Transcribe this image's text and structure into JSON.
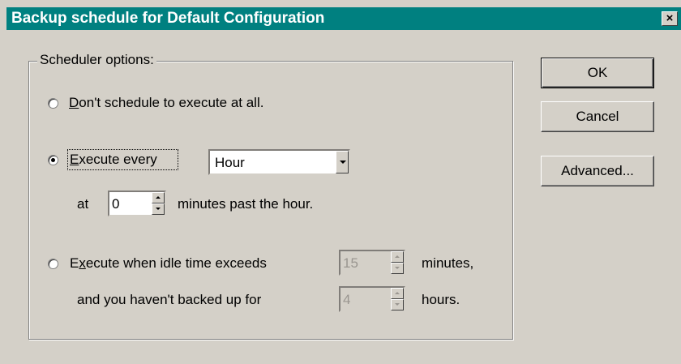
{
  "window": {
    "title": "Backup schedule for Default Configuration",
    "close_label": "×"
  },
  "group": {
    "label": "Scheduler options:"
  },
  "options": {
    "dont_schedule": {
      "prefix": "",
      "accel": "D",
      "rest": "on't schedule to execute at all.",
      "checked": false
    },
    "execute_every": {
      "prefix": "",
      "accel": "E",
      "rest": "xecute every",
      "checked": true
    },
    "idle": {
      "prefix": "E",
      "accel": "x",
      "rest": "ecute when idle time exceeds",
      "checked": false
    }
  },
  "every": {
    "interval": "Hour",
    "at_label": "at",
    "minutes_value": "0",
    "minutes_suffix": "minutes past the hour."
  },
  "idle": {
    "idle_value": "15",
    "idle_suffix": "minutes,",
    "backup_label": "and you haven't backed up for",
    "hours_value": "4",
    "hours_suffix": "hours."
  },
  "buttons": {
    "ok": "OK",
    "cancel": "Cancel",
    "advanced": "Advanced..."
  }
}
